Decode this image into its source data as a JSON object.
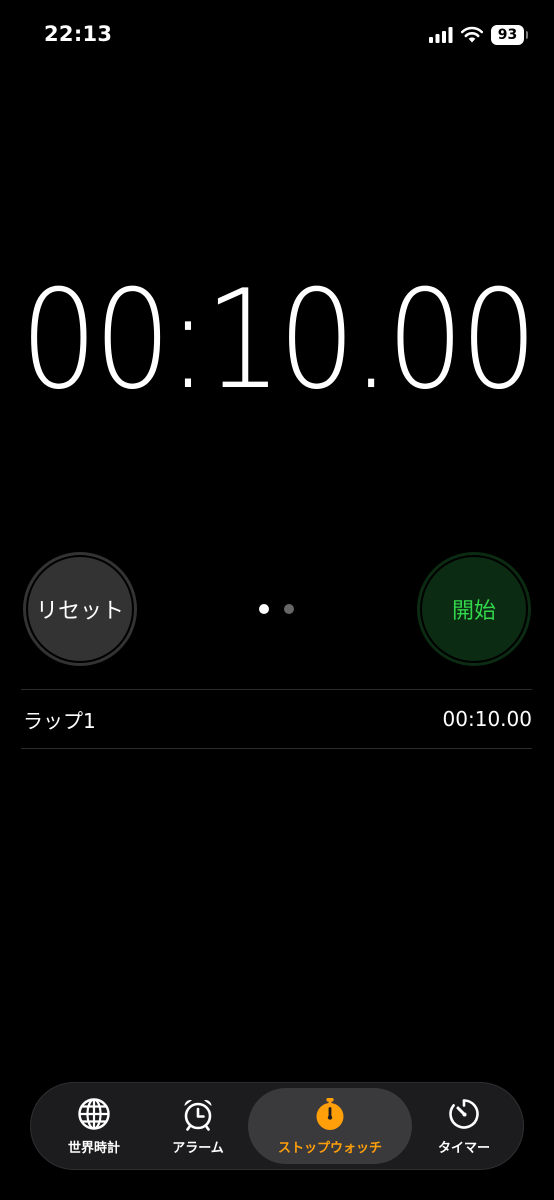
{
  "status_bar": {
    "time": "22:13",
    "battery": "93",
    "icons": [
      "signal-icon",
      "wifi-icon",
      "battery-icon"
    ]
  },
  "stopwatch": {
    "display": "00:10.00",
    "reset_label": "リセット",
    "start_label": "開始",
    "page_count": 2,
    "current_page": 1
  },
  "laps": [
    {
      "label": "ラップ1",
      "time": "00:10.00"
    }
  ],
  "tab_bar": {
    "tabs": [
      {
        "label": "世界時計",
        "icon": "globe-icon"
      },
      {
        "label": "アラーム",
        "icon": "alarm-clock-icon"
      },
      {
        "label": "ストップウォッチ",
        "icon": "stopwatch-icon",
        "selected": true
      },
      {
        "label": "タイマー",
        "icon": "timer-icon"
      }
    ]
  },
  "colors": {
    "background": "#000000",
    "accent": "#ff9f0a",
    "start_text": "#32d74b",
    "start_bg": "#0b2b12",
    "reset_bg": "#333333"
  }
}
